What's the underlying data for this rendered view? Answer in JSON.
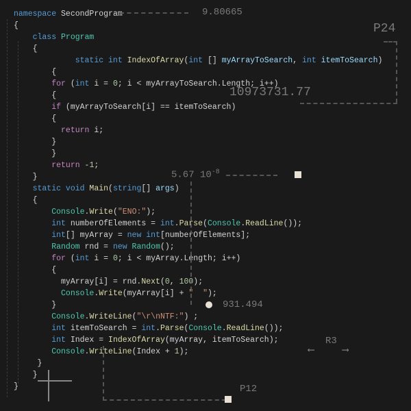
{
  "code": {
    "l1a": "namespace",
    "l1b": " SecondProgram",
    "l2": "{",
    "l3a": "    class",
    "l3b": " Program",
    "l4": "    {",
    "l5a": "             static",
    "l5b": " int",
    "l5c": " IndexOfArray",
    "l5d": "(",
    "l5e": "int",
    "l5f": " [] ",
    "l5g": "myArrayToSearch",
    "l5h": ", ",
    "l5i": "int",
    "l5j": " itemToSearch",
    "l5k": ")",
    "l6": "        {",
    "l7a": "        for",
    "l7b": " (",
    "l7c": "int",
    "l7d": " i = ",
    "l7e": "0",
    "l7f": "; i < myArrayToSearch.Length; i++)",
    "l8": "        {",
    "l9a": "        if",
    "l9b": " (myArrayToSearch[i] == itemToSearch)",
    "l10": "        {",
    "l11a": "          return",
    "l11b": " i;",
    "l12": "        }",
    "l13": "        }",
    "l14a": "        return",
    "l14b": " -",
    "l14c": "1",
    "l14d": ";",
    "l15": "    }",
    "l16a": "    static",
    "l16b": " void",
    "l16c": " Main",
    "l16d": "(",
    "l16e": "string",
    "l16f": "[] ",
    "l16g": "args",
    "l16h": ")",
    "l17": "    {",
    "l18a": "        Console",
    "l18b": ".",
    "l18c": "Write",
    "l18d": "(",
    "l18e": "\"ENO:\"",
    "l18f": ");",
    "l19a": "        int",
    "l19b": " numberOfElements = ",
    "l19c": "int",
    "l19d": ".",
    "l19e": "Parse",
    "l19f": "(",
    "l19g": "Console",
    "l19h": ".",
    "l19i": "ReadLine",
    "l19j": "());",
    "blank1": "",
    "l20a": "        int",
    "l20b": "[] myArray = ",
    "l20c": "new",
    "l20d": " int",
    "l20e": "[numberOfElements];",
    "l21a": "        Random",
    "l21b": " rnd = ",
    "l21c": "new",
    "l21d": " Random",
    "l21e": "();",
    "blank2": "",
    "l22a": "        for",
    "l22b": " (",
    "l22c": "int",
    "l22d": " i = ",
    "l22e": "0",
    "l22f": "; i < myArray.Length; i++)",
    "l23": "        {",
    "l24a": "          myArray[i] = rnd.",
    "l24b": "Next",
    "l24c": "(",
    "l24d": "0",
    "l24e": ", ",
    "l24f": "100",
    "l24g": ");",
    "l25a": "          Console",
    "l25b": ".",
    "l25c": "Write",
    "l25d": "(myArray[i] + ",
    "l25e": "\"  \"",
    "l25f": ");",
    "l26": "        }",
    "blank3": "",
    "l27a": "        Console",
    "l27b": ".",
    "l27c": "WriteLine",
    "l27d": "(",
    "l27e": "\"\\r\\nNTF:\"",
    "l27f": ") ;",
    "l28a": "        int",
    "l28b": " itemToSearch = ",
    "l28c": "int",
    "l28d": ".",
    "l28e": "Parse",
    "l28f": "(",
    "l28g": "Console",
    "l28h": ".",
    "l28i": "ReadLine",
    "l28j": "());",
    "blank4": "",
    "l29a": "        int",
    "l29b": " Index = ",
    "l29c": "IndexOfArray",
    "l29d": "(myArray, itemToSearch);",
    "l30a": "        Console",
    "l30b": ".",
    "l30c": "WriteLine",
    "l30d": "(Index + ",
    "l30e": "1",
    "l30f": ");",
    "l31": "     }",
    "l32": "    }",
    "l33": "}"
  },
  "annotations": {
    "a1": "9.80665",
    "a2": "P24",
    "a3": "10973731.77",
    "a4": "5.67 10",
    "a4sup": "-8",
    "a5": "931.494",
    "a6": "R3",
    "a7": "P12"
  }
}
